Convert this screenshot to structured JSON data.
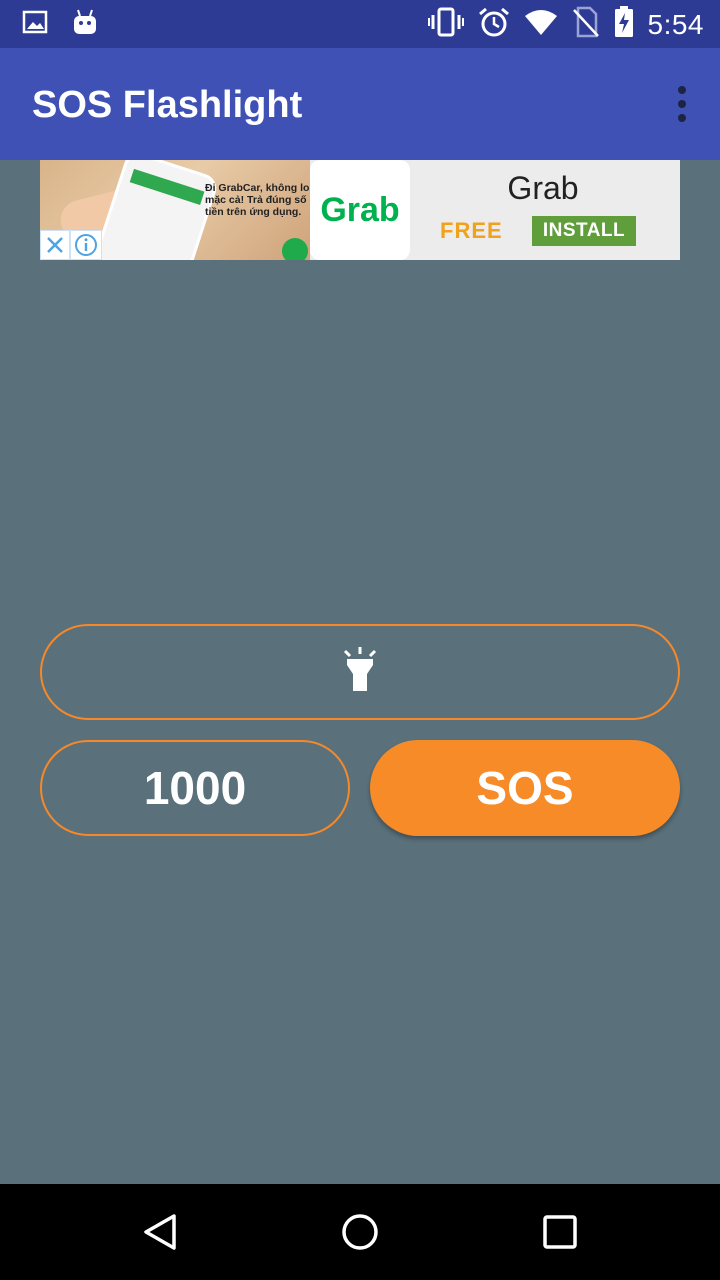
{
  "status_bar": {
    "time": "5:54",
    "left_icons": [
      "image-icon",
      "android-icon"
    ],
    "right_icons": [
      "vibrate-icon",
      "alarm-icon",
      "wifi-icon",
      "no-sim-icon",
      "battery-charging-icon"
    ]
  },
  "app_bar": {
    "title": "SOS Flashlight",
    "overflow_icon": "more-vert-icon"
  },
  "ad": {
    "image_text": "Đi GrabCar, không lo\nmặc cả! Trả đúng số\ntiền trên ứng dụng.",
    "logo_text": "Grab",
    "app_name": "Grab",
    "price_label": "FREE",
    "install_label": "INSTALL",
    "close_icon": "close-icon",
    "info_icon": "info-icon"
  },
  "controls": {
    "flash_icon": "flashlight-icon",
    "interval_value": "1000",
    "sos_label": "SOS"
  },
  "nav_bar": {
    "icons": [
      "back-icon",
      "home-icon",
      "recents-icon"
    ]
  },
  "colors": {
    "status_bar": "#2e3b94",
    "app_bar": "#3f51b5",
    "background": "#5a707b",
    "accent": "#f68b28",
    "install_green": "#5f9e3a",
    "free_orange": "#f0a21c",
    "grab_green": "#00b14f"
  }
}
